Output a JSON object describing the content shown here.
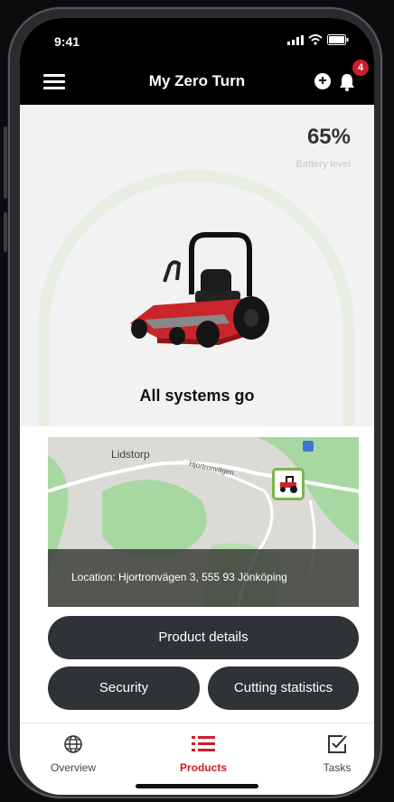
{
  "status_bar": {
    "time": "9:41"
  },
  "header": {
    "title": "My Zero Turn",
    "notification_count": "4"
  },
  "battery": {
    "value": "65%",
    "label": "Battery level"
  },
  "product": {
    "status": "All systems go"
  },
  "map": {
    "place_label": "Lidstorp",
    "road_label": "Hjortronvägen",
    "location_text": "Location: Hjortronvägen 3, 555 93 Jönköping"
  },
  "actions": {
    "details": "Product details",
    "security": "Security",
    "cutting": "Cutting statistics"
  },
  "tabs": [
    {
      "label": "Overview",
      "icon": "globe-icon"
    },
    {
      "label": "Products",
      "icon": "list-icon"
    },
    {
      "label": "Tasks",
      "icon": "checkbox-icon"
    }
  ],
  "colors": {
    "accent": "#d01d2a",
    "map_pin": "#7ab648",
    "button": "#2f3236"
  }
}
